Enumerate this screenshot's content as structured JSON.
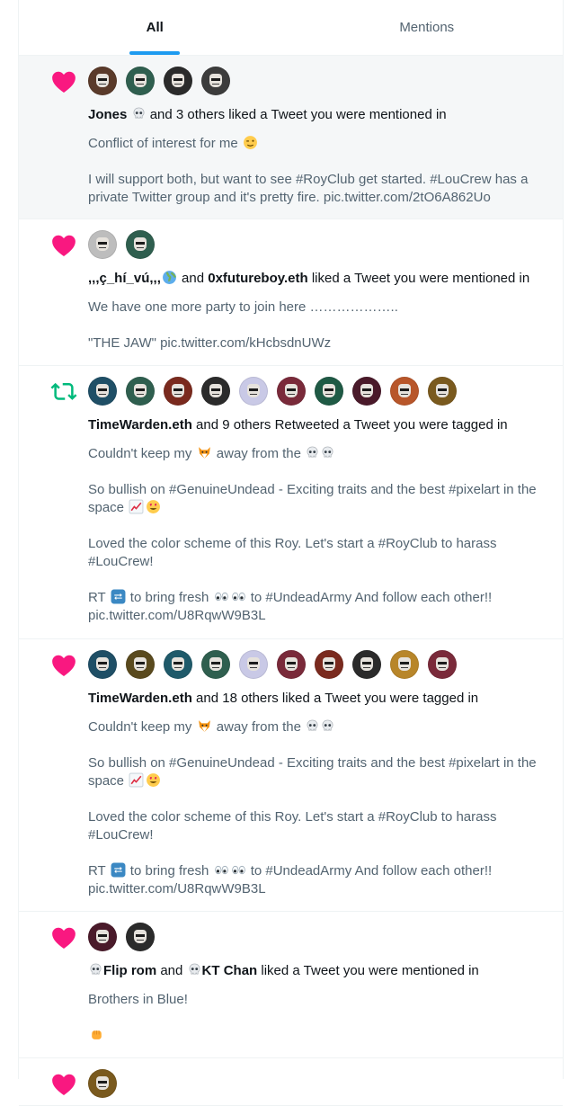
{
  "tabs": [
    {
      "label": "All",
      "active": true
    },
    {
      "label": "Mentions",
      "active": false
    }
  ],
  "colors": {
    "accent": "#1d9bf0",
    "like": "#f91880",
    "retweet": "#00ba7c",
    "text_primary": "#0f1419",
    "text_secondary": "#536471",
    "highlight_bg": "#f5f7f8"
  },
  "notifications": [
    {
      "kind": "heart-icon",
      "avatars": [
        "#5a3a2a",
        "#2f5f4f",
        "#2b2b2b",
        "#3c3c3c"
      ],
      "actor_name": "Jones",
      "actor_rest": "and 3 others liked a Tweet you were mentioned in",
      "tweet": [
        "Conflict of interest for me",
        "I will support both, but want to see #RoyClub get started.  #LouCrew has a private Twitter group and it's pretty fire. pic.twitter.com/2tO6A862Uo"
      ]
    },
    {
      "kind": "heart-icon",
      "avatars": [
        "#bdbdbd",
        "#2f5f4f"
      ],
      "actor_name": ",,,ç_hí_vú,,,",
      "connector": "and",
      "actor_name2": "0xfutureboy.eth",
      "actor_rest": "liked a Tweet you were mentioned in",
      "tweet": [
        "We have one more party to join here ………………..",
        "\"THE JAW\" pic.twitter.com/kHcbsdnUWz"
      ]
    },
    {
      "kind": "retweet-icon",
      "avatars": [
        "#1f4f66",
        "#2f5f4f",
        "#7a2a1e",
        "#2b2b2b",
        "#c9c9e6",
        "#7a2a3a",
        "#1f5a45",
        "#4a1a2a",
        "#b8562a",
        "#7a5a1e"
      ],
      "actor_name": "TimeWarden.eth",
      "actor_rest": "and 9 others Retweeted a Tweet you were tagged in",
      "tweet": [
        "Couldn't keep my",
        "away from the",
        "So bullish on #GenuineUndead -  Exciting traits and the best #pixelart in the space",
        "Loved the color scheme of this Roy. Let's start a #RoyClub to harass #LouCrew!",
        "RT",
        "to bring fresh",
        "to #UndeadArmy  And follow each other!!",
        "pic.twitter.com/U8RqwW9B3L"
      ]
    },
    {
      "kind": "heart-icon",
      "avatars": [
        "#1f4f66",
        "#5a4a1e",
        "#1f5a6a",
        "#2f5f4f",
        "#c9c9e6",
        "#7a2a3a",
        "#7a2a1e",
        "#2b2b2b",
        "#b8862a",
        "#7a2a3a"
      ],
      "actor_name": "TimeWarden.eth",
      "actor_rest": "and 18 others liked a Tweet you were tagged in",
      "tweet": [
        "Couldn't keep my",
        "away from the",
        "So bullish on #GenuineUndead -  Exciting traits and the best #pixelart in the space",
        "Loved the color scheme of this Roy. Let's start a #RoyClub to harass #LouCrew!",
        "RT",
        "to bring fresh",
        "to #UndeadArmy  And follow each other!!",
        "pic.twitter.com/U8RqwW9B3L"
      ]
    },
    {
      "kind": "heart-icon",
      "avatars": [
        "#4a1a2a",
        "#2b2b2b"
      ],
      "actor_name": "Flip rom",
      "connector": "and",
      "actor_name2": "KT Chan",
      "actor_rest": "liked a Tweet you were mentioned in",
      "tweet": [
        "Brothers in Blue!"
      ]
    },
    {
      "kind": "heart-icon",
      "avatars": [
        "#7a5a1e"
      ]
    }
  ]
}
